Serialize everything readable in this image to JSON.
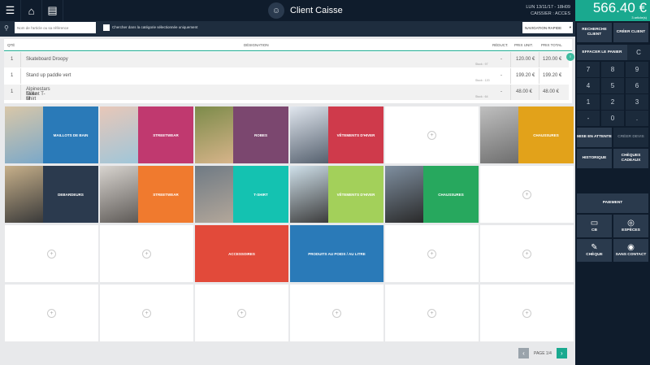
{
  "header": {
    "client": "Client Caisse",
    "datetime": "LUN 13/11/17 - 18H09",
    "cashier": "CAISSIER : ACCES",
    "total": "566.40 €",
    "articles": "3 article(s)"
  },
  "search": {
    "placeholder": "Nom de l'article ou sa référence",
    "checkbox_label": "Chercher dans la catégorie sélectionnée uniquement",
    "nav_select": "NAVIGATION RAPIDE"
  },
  "table": {
    "headers": {
      "qty": "QTÉ",
      "designation": "DÉSIGNATION",
      "discount": "RÉDUCT.",
      "unit": "PRIX UNIT.",
      "total": "PRIX TOTAL"
    },
    "rows": [
      {
        "qty": "1",
        "name": "Skateboard Droopy",
        "name2": "",
        "stock": "Stock : 97",
        "discount": "-",
        "unit": "120.00 €",
        "total": "120.00 €"
      },
      {
        "qty": "1",
        "name": "Stand up paddle vert",
        "name2": "",
        "stock": "Stock : 120",
        "discount": "-",
        "unit": "199.20 €",
        "total": "199.20 €"
      },
      {
        "qty": "1",
        "name": "Alpinestars Mount T-Shirt",
        "name2": "Taille M",
        "stock": "Stock : 64",
        "discount": "-",
        "unit": "48.00 €",
        "total": "48.00 €"
      }
    ]
  },
  "tiles": [
    {
      "label": "MAILLOTS DE BAIN",
      "color": "#2a7ab8",
      "img": true
    },
    {
      "label": "STREETWEAR",
      "color": "#c0396f",
      "img": true
    },
    {
      "label": "ROBES",
      "color": "#7b476f",
      "img": true
    },
    {
      "label": "VÊTEMENTS D'HIVER",
      "color": "#cf3a4b",
      "img": true
    },
    {
      "label": "",
      "color": "",
      "img": false
    },
    {
      "label": "CHAUSSURES",
      "color": "#e2a21a",
      "img": true
    },
    {
      "label": "DEBARDEURS",
      "color": "#2b3a4e",
      "img": true
    },
    {
      "label": "STREETWEAR",
      "color": "#f07a2e",
      "img": true
    },
    {
      "label": "T-SHIRT",
      "color": "#14c2b1",
      "img": true
    },
    {
      "label": "VÊTEMENTS D'HIVER",
      "color": "#a3d05a",
      "img": true
    },
    {
      "label": "CHAUSSURES",
      "color": "#27a85e",
      "img": true
    },
    {
      "label": "",
      "color": "",
      "img": false
    },
    {
      "label": "",
      "color": "",
      "img": false
    },
    {
      "label": "",
      "color": "",
      "img": false
    },
    {
      "label": "ACCESSOIRES",
      "color": "#e24a3a",
      "img": false
    },
    {
      "label": "PRODUITS AU POIDS / AU LITRE",
      "color": "#2a7ab8",
      "img": false
    },
    {
      "label": "",
      "color": "",
      "img": false
    },
    {
      "label": "",
      "color": "",
      "img": false
    },
    {
      "label": "",
      "color": "",
      "img": false
    },
    {
      "label": "",
      "color": "",
      "img": false
    },
    {
      "label": "",
      "color": "",
      "img": false
    },
    {
      "label": "",
      "color": "",
      "img": false
    },
    {
      "label": "",
      "color": "",
      "img": false
    },
    {
      "label": "",
      "color": "",
      "img": false
    }
  ],
  "pager": {
    "prev": "‹",
    "next": "›",
    "label": "PAGE 1/4"
  },
  "panel": {
    "search_client": "RECHERCHE CLIENT",
    "create_client": "CRÉER CLIENT",
    "clear_cart": "EFFACER LE PANIER",
    "clear": "C",
    "keys": [
      "7",
      "8",
      "9",
      "4",
      "5",
      "6",
      "1",
      "2",
      "3",
      "-",
      "0",
      "."
    ],
    "hold": "MISE EN ATTENTE",
    "quote": "CRÉER DEVIS",
    "history": "HISTORIQUE",
    "gift": "CHÈQUES CADEAUX",
    "payment": "PAIEMENT",
    "cb": "CB",
    "cash": "ESPÈCES",
    "cheque": "CHÈQUE",
    "contactless": "SANS CONTACT"
  },
  "colors": {
    "accent": "#1aa98f",
    "dark": "#0f1c2c"
  }
}
